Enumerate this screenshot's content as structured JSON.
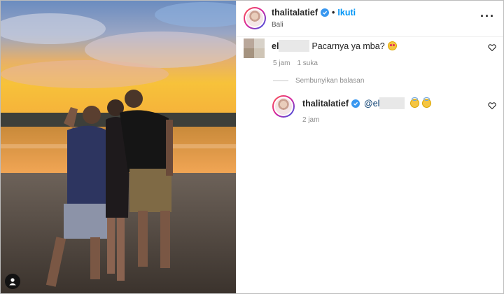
{
  "post": {
    "author": {
      "username": "thalitalatief",
      "verified": true,
      "follow_label": "Ikuti",
      "separator": "•",
      "location": "Bali"
    }
  },
  "comments": [
    {
      "username": "el",
      "text": "Pacarnya ya mba?",
      "emoji": "heart-eyes-emoji",
      "time": "5 jam",
      "likes": "1 suka",
      "hide_replies_label": "Sembunyikan balasan",
      "reply": {
        "username": "thalitalatief",
        "verified": true,
        "mention": "@el",
        "emojis": [
          "angel-emoji",
          "angel-emoji"
        ],
        "time": "2 jam"
      }
    }
  ],
  "icons": {
    "more": "more-options-icon",
    "like": "heart-icon",
    "tagged_users": "person-tag-icon"
  },
  "colors": {
    "link_blue": "#0095f6",
    "verified_blue": "#3897f0",
    "muted_text": "#8e8e8e"
  }
}
